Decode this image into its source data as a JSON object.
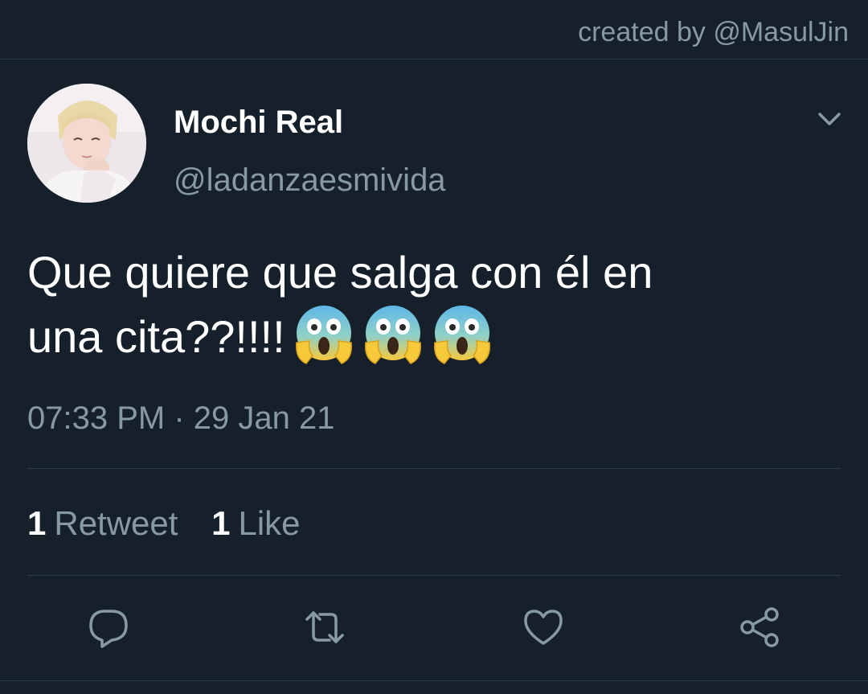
{
  "credit": {
    "text": "created by @MasulJin"
  },
  "tweet": {
    "display_name": "Mochi Real",
    "handle": "@ladanzaesmivida",
    "text_line1": "Que quiere que salga con él en",
    "text_line2": "una cita??!!!!",
    "emojis": [
      "face-screaming-in-fear",
      "face-screaming-in-fear",
      "face-screaming-in-fear"
    ],
    "timestamp": "07:33 PM · 29 Jan 21"
  },
  "stats": {
    "retweets_count": "1",
    "retweets_label": "Retweet",
    "likes_count": "1",
    "likes_label": "Like"
  },
  "actions": [
    "reply-icon",
    "retweet-icon",
    "like-icon",
    "share-icon"
  ],
  "colors": {
    "background": "#15202b",
    "divider": "#2f3d4a",
    "secondary_text": "#8899a6",
    "primary_text": "#ffffff"
  }
}
